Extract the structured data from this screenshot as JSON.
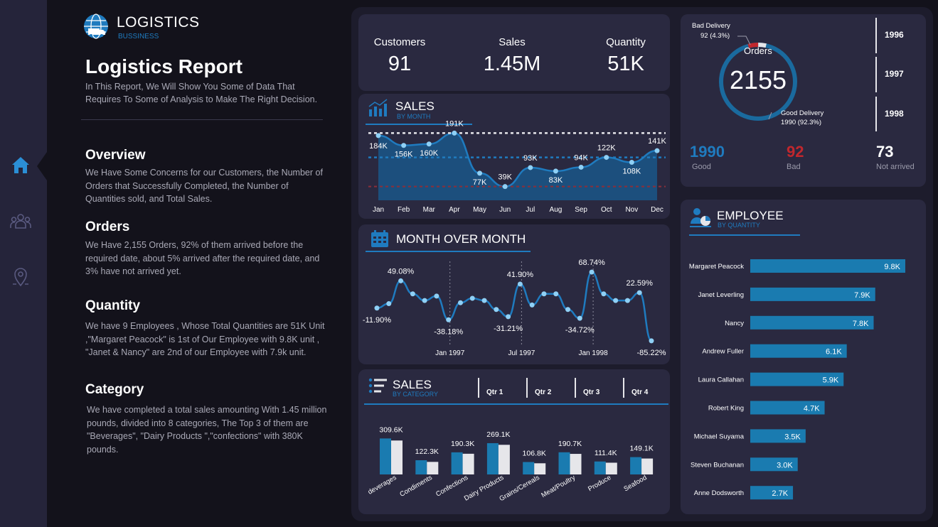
{
  "brand": {
    "title": "LOGISTICS",
    "subtitle": "BUSSINESS"
  },
  "report": {
    "title": "Logistics Report",
    "description": "In This Report, We Will Show You Some of Data That Requires To Some of Analysis to Make The Right Decision."
  },
  "sections": [
    {
      "heading": "Overview",
      "text": "We Have Some Concerns for our Customers, the Number of Orders that Successfully Completed, the Number of Quantities sold, and Total Sales."
    },
    {
      "heading": "Orders",
      "text": "We Have 2,155 Orders, 92% of them arrived before the required date, about 5% arrived after the required date, and 3% have not arrived yet."
    },
    {
      "heading": "Quantity",
      "text": "We have 9 Employees , Whose Total Quantities are 51K Unit ,\"Margaret Peacock\" is 1st of Our Employee with 9.8K unit , \"Janet & Nancy\" are 2nd of our Employee with 7.9k unit."
    },
    {
      "heading": "Category",
      "text": "We have completed a total sales amounting With 1.45 million pounds, divided into 8 categories, The Top 3 of them are \"Beverages\", \"Dairy Products \",\"confections\" with 380K pounds."
    }
  ],
  "nav": {
    "items": [
      "home-icon",
      "people-icon",
      "location-icon"
    ],
    "active": "home-icon"
  },
  "kpis": [
    {
      "label": "Customers",
      "value": "91"
    },
    {
      "label": "Sales",
      "value": "1.45M"
    },
    {
      "label": "Quantity",
      "value": "51K"
    }
  ],
  "orders": {
    "label": "Orders",
    "total": "2155",
    "bad_delivery_label": "Bad Delivery",
    "bad_delivery_value": "92 (4.3%)",
    "good_delivery_label": "Good Delivery",
    "good_delivery_value": "1990 (92.3%)",
    "years": [
      "1996",
      "1997",
      "1998"
    ],
    "stats": [
      {
        "value": "1990",
        "label": "Good",
        "color": "#1f7bbf"
      },
      {
        "value": "92",
        "label": "Bad",
        "color": "#c1272d"
      },
      {
        "value": "73",
        "label": "Not arrived",
        "color": "#ffffff"
      }
    ],
    "gauge_fractions": {
      "good": 0.923,
      "bad": 0.043,
      "not_arrived": 0.034
    }
  },
  "sales_by_month": {
    "title": "SALES",
    "subtitle": "BY MONTH",
    "chart_data": {
      "type": "area",
      "categories": [
        "Jan",
        "Feb",
        "Mar",
        "Apr",
        "May",
        "Jun",
        "Jul",
        "Aug",
        "Sep",
        "Oct",
        "Nov",
        "Dec"
      ],
      "values": [
        184,
        156,
        160,
        191,
        77,
        39,
        93,
        83,
        94,
        122,
        108,
        141
      ],
      "labels": [
        "184K",
        "156K",
        "160K",
        "191K",
        "77K",
        "39K",
        "93K",
        "83K",
        "94K",
        "122K",
        "108K",
        "141K"
      ],
      "ylim": [
        0,
        210
      ],
      "reference_lines": {
        "max": 191,
        "average": 122,
        "min": 39
      }
    }
  },
  "month_over_month": {
    "title": "MONTH OVER MONTH",
    "chart_data": {
      "type": "line",
      "values": [
        -11.9,
        -2,
        49.08,
        20,
        5,
        15,
        -38.18,
        0,
        10,
        5,
        -15,
        -31.21,
        41.9,
        -5,
        20,
        20,
        -15,
        -34.72,
        68.74,
        20,
        5,
        5,
        22.59,
        -85.22
      ],
      "point_labels": [
        {
          "index": 0,
          "text": "-11.90%"
        },
        {
          "index": 2,
          "text": "49.08%"
        },
        {
          "index": 6,
          "text": "-38.18%"
        },
        {
          "index": 11,
          "text": "-31.21%"
        },
        {
          "index": 12,
          "text": "41.90%"
        },
        {
          "index": 17,
          "text": "-34.72%"
        },
        {
          "index": 18,
          "text": "68.74%"
        },
        {
          "index": 22,
          "text": "22.59%"
        },
        {
          "index": 23,
          "text": "-85.22%"
        }
      ],
      "period_markers": [
        {
          "index": 6,
          "text": "Jan 1997"
        },
        {
          "index": 12,
          "text": "Jul 1997"
        },
        {
          "index": 18,
          "text": "Jan 1998"
        }
      ],
      "ylim": [
        -95,
        80
      ]
    }
  },
  "sales_by_category": {
    "title": "SALES",
    "subtitle": "BY CATEGORY",
    "quarters": [
      "Qtr 1",
      "Qtr 2",
      "Qtr 3",
      "Qtr 4"
    ],
    "chart_data": {
      "type": "bar",
      "categories": [
        "Beverages",
        "Condiments",
        "Confections",
        "Dairy Products",
        "Grains/Cereals",
        "Meat/Poultry",
        "Produce",
        "Seafood"
      ],
      "category_labels": [
        "deverages",
        "Condiments",
        "Confections",
        "Dairy Products",
        "Grains/Cereals",
        "Meat/Poultry",
        "Produce",
        "Seafood"
      ],
      "series": [
        {
          "values": [
            309.6,
            122.3,
            190.3,
            269.1,
            106.8,
            190.7,
            111.4,
            149.1
          ],
          "color": "#1a7bb0"
        },
        {
          "values": [
            292,
            108,
            178,
            255,
            96,
            177,
            101,
            137
          ],
          "color": "#e6e6ea"
        }
      ],
      "labels": [
        "309.6K",
        "122.3K",
        "190.3K",
        "269.1K",
        "106.8K",
        "190.7K",
        "111.4K",
        "149.1K"
      ],
      "ylim": [
        0,
        330
      ]
    }
  },
  "employee": {
    "title": "EMPLOYEE",
    "subtitle": "BY QUANTITY",
    "chart_data": {
      "type": "bar",
      "orientation": "horizontal",
      "categories": [
        "Margaret Peacock",
        "Janet Leverling",
        "Nancy",
        "Andrew Fuller",
        "Laura Callahan",
        "Robert King",
        "Michael Suyama",
        "Steven Buchanan",
        "Anne Dodsworth"
      ],
      "values": [
        9.8,
        7.9,
        7.8,
        6.1,
        5.9,
        4.7,
        3.5,
        3.0,
        2.7
      ],
      "labels": [
        "9.8K",
        "7.9K",
        "7.8K",
        "6.1K",
        "5.9K",
        "4.7K",
        "3.5K",
        "3.0K",
        "2.7K"
      ],
      "xlim": [
        0,
        9.8
      ],
      "color": "#1a7bb0"
    }
  },
  "colors": {
    "accent": "#1f7bbf",
    "bar": "#1a7bb0",
    "bad": "#c1272d",
    "card": "#2a2940",
    "line": "#1f7bbf"
  }
}
